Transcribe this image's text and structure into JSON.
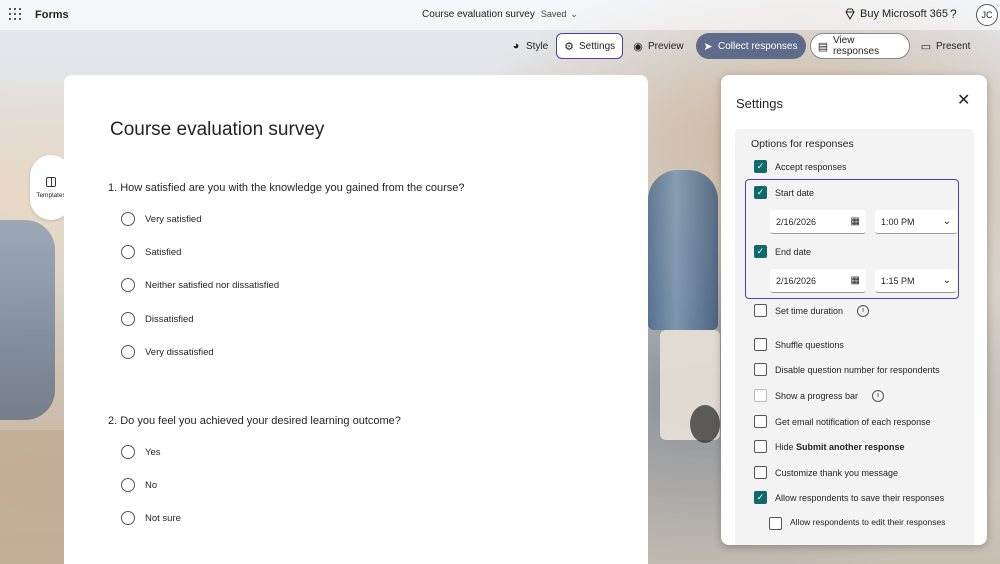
{
  "app": {
    "name": "Forms"
  },
  "document": {
    "title": "Course evaluation survey",
    "status": "Saved"
  },
  "account": {
    "buy_label": "Buy Microsoft 365",
    "help": "?",
    "initials": "JC"
  },
  "toolbar": {
    "style": "Style",
    "settings": "Settings",
    "preview": "Preview",
    "collect": "Collect responses",
    "view": "View responses",
    "present": "Present"
  },
  "templates": {
    "label": "Templates"
  },
  "form": {
    "title": "Course evaluation survey",
    "questions": [
      {
        "text": "1. How satisfied are you with the knowledge you gained from the course?",
        "options": [
          "Very satisfied",
          "Satisfied",
          "Neither satisfied nor dissatisfied",
          "Dissatisfied",
          "Very dissatisfied"
        ]
      },
      {
        "text": "2. Do you feel you achieved your desired learning outcome?",
        "options": [
          "Yes",
          "No",
          "Not sure"
        ]
      }
    ]
  },
  "settings": {
    "title": "Settings",
    "section_title": "Options for responses",
    "accept_responses": {
      "label": "Accept responses",
      "checked": true
    },
    "start_date": {
      "label": "Start date",
      "checked": true,
      "date": "2/16/2026",
      "time": "1:00 PM"
    },
    "end_date": {
      "label": "End date",
      "checked": true,
      "date": "2/16/2026",
      "time": "1:15 PM"
    },
    "time_duration": {
      "label": "Set time duration",
      "checked": false
    },
    "shuffle": {
      "label": "Shuffle questions",
      "checked": false
    },
    "disable_qnum": {
      "label": "Disable question number for respondents",
      "checked": false
    },
    "progress_bar": {
      "label": "Show a progress bar",
      "checked": false
    },
    "email_notif": {
      "label": "Get email notification of each response",
      "checked": false
    },
    "hide_submit": {
      "prefix": "Hide ",
      "bold": "Submit another response",
      "checked": false
    },
    "thank_you": {
      "label": "Customize thank you message",
      "checked": false
    },
    "save_responses": {
      "label": "Allow respondents to save their responses",
      "checked": true
    },
    "edit_responses": {
      "label": "Allow respondents to edit their responses",
      "checked": false
    }
  },
  "colors": {
    "accent": "#4f3ea8",
    "checkbox": "#0f6b6b",
    "collect_btn": "#5f6b8a"
  }
}
